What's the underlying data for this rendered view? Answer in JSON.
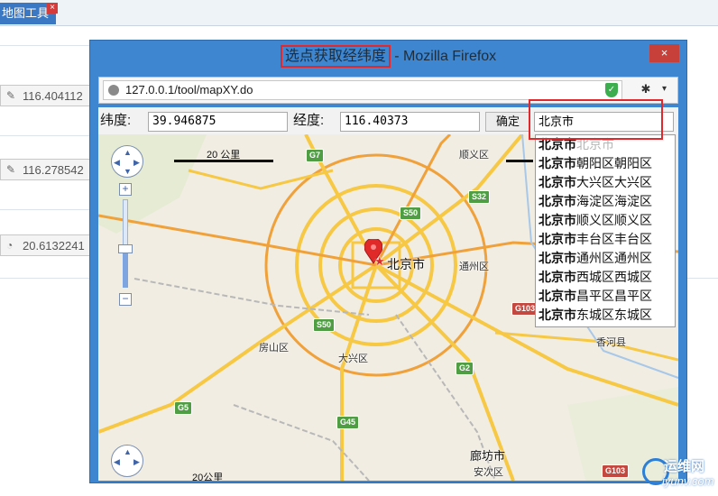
{
  "background_app": {
    "tab_label": "地图工具",
    "tab_close": "×",
    "rows": [
      "116.404112",
      "116.278542",
      "20.6132241"
    ]
  },
  "window": {
    "title_highlight": "选点获取经纬度",
    "title_rest": " - Mozilla Firefox",
    "close": "×"
  },
  "urlbar": {
    "url": "127.0.0.1/tool/mapXY.do",
    "menu": "▾"
  },
  "controls": {
    "lat_label": "纬度:",
    "lat_value": "39.946875",
    "lng_label": "经度:",
    "lng_value": "116.40373",
    "ok_label": "确定",
    "search_value": "北京市"
  },
  "suggestions": [
    {
      "bold": "北京市",
      "rest": "北京市",
      "light": true
    },
    {
      "bold": "北京市",
      "rest": "朝阳区朝阳区",
      "light": false
    },
    {
      "bold": "北京市",
      "rest": "大兴区大兴区",
      "light": false
    },
    {
      "bold": "北京市",
      "rest": "海淀区海淀区",
      "light": false
    },
    {
      "bold": "北京市",
      "rest": "顺义区顺义区",
      "light": false
    },
    {
      "bold": "北京市",
      "rest": "丰台区丰台区",
      "light": false
    },
    {
      "bold": "北京市",
      "rest": "通州区通州区",
      "light": false
    },
    {
      "bold": "北京市",
      "rest": "西城区西城区",
      "light": false
    },
    {
      "bold": "北京市",
      "rest": "昌平区昌平区",
      "light": false
    },
    {
      "bold": "北京市",
      "rest": "东城区东城区",
      "light": false
    }
  ],
  "map": {
    "scale_label": "20 公里",
    "scale_label_bottom": "20公里",
    "city_label": "北京市",
    "zoom_in": "+",
    "zoom_out": "−",
    "labels": {
      "shunyi": "顺义区",
      "tongzhou": "通州区",
      "fangshan": "房山区",
      "daxing": "大兴区",
      "xianghe": "香河县",
      "langfang": "廊坊市",
      "anci": "安次区"
    },
    "shields": {
      "g7": "G7",
      "s32": "S32",
      "s50": "S50",
      "s50b": "S50",
      "g103": "G103",
      "g2": "G2",
      "g5": "G5",
      "g45": "G45",
      "g103b": "G103"
    }
  },
  "watermark": {
    "title": "运维网",
    "sub": "iyunv.com"
  },
  "colors": {
    "window_blue": "#3e86cf",
    "highlight_red": "#e0282d",
    "road_yellow": "#f7c844",
    "road_orange": "#f0a13a"
  }
}
